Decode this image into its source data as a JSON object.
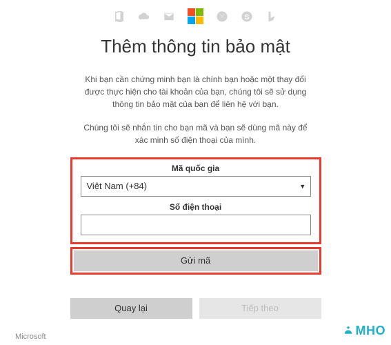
{
  "header": {
    "icons": [
      "office",
      "onedrive",
      "outlook",
      "microsoft-logo",
      "xbox",
      "skype",
      "bing"
    ]
  },
  "title": "Thêm thông tin bảo mật",
  "paragraphs": {
    "p1": "Khi bạn cần chứng minh bạn là chính bạn hoặc một thay đổi được thực hiện cho tài khoản của bạn, chúng tôi sẽ sử dụng thông tin bảo mật của bạn để liên hệ với bạn.",
    "p2": "Chúng tôi sẽ nhắn tin cho bạn mã và bạn sẽ dùng mã này để xác minh số điện thoại của mình."
  },
  "form": {
    "country_label": "Mã quốc gia",
    "country_value": "Việt Nam (+84)",
    "phone_label": "Số điện thoại",
    "phone_value": ""
  },
  "buttons": {
    "send_code": "Gửi mã",
    "back": "Quay lại",
    "next": "Tiếp theo"
  },
  "footer": {
    "brand": "Microsoft"
  },
  "watermark": {
    "text": "MHO"
  },
  "colors": {
    "highlight_box": "#e83b2e",
    "watermark": "#1fb1c9"
  }
}
